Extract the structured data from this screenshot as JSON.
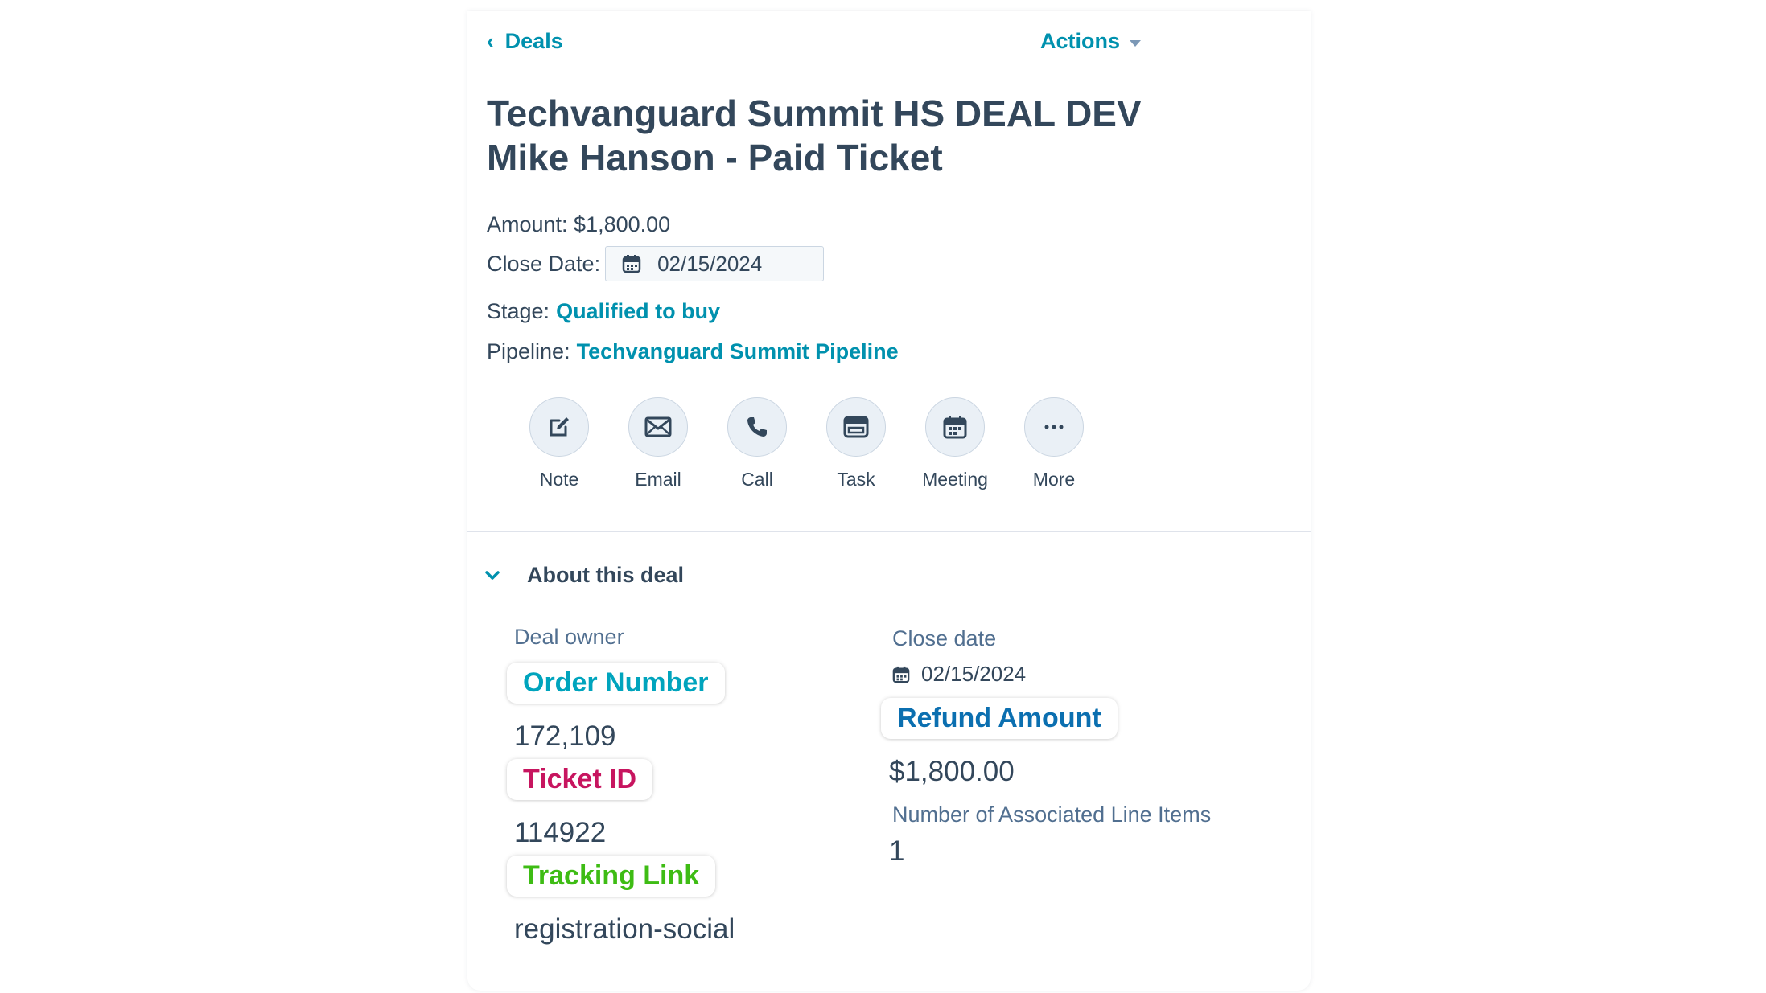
{
  "nav": {
    "back_label": "Deals",
    "actions_label": "Actions"
  },
  "deal": {
    "title_line1": "Techvanguard Summit HS DEAL DEV",
    "title_line2": "Mike Hanson - Paid Ticket",
    "amount_label": "Amount: $1,800.00",
    "close_date_label": "Close Date:",
    "close_date_value": "02/15/2024",
    "stage_label": "Stage:",
    "stage_value": "Qualified to buy",
    "pipeline_label": "Pipeline:",
    "pipeline_value": "Techvanguard Summit Pipeline"
  },
  "activities": [
    {
      "label": "Note",
      "icon": "note-icon"
    },
    {
      "label": "Email",
      "icon": "email-icon"
    },
    {
      "label": "Call",
      "icon": "call-icon"
    },
    {
      "label": "Task",
      "icon": "task-icon"
    },
    {
      "label": "Meeting",
      "icon": "meeting-icon"
    },
    {
      "label": "More",
      "icon": "more-icon"
    }
  ],
  "about": {
    "header": "About this deal",
    "deal_owner_label": "Deal owner",
    "close_date_label": "Close date",
    "close_date_value": "02/15/2024",
    "order_number_label": "Order Number",
    "order_number_value": "172,109",
    "ticket_id_label": "Ticket ID",
    "ticket_id_value": "114922",
    "tracking_link_label": "Tracking Link",
    "tracking_link_value": "registration-social",
    "refund_amount_label": "Refund Amount",
    "refund_amount_value": "$1,800.00",
    "line_items_label": "Number of Associated Line Items",
    "line_items_value": "1"
  },
  "colors": {
    "link": "#0091ae",
    "text": "#33475b",
    "order_number": "#00a4bd",
    "ticket_id": "#c7155f",
    "tracking_link": "#3ebc14",
    "refund_amount": "#0b6fb0"
  }
}
